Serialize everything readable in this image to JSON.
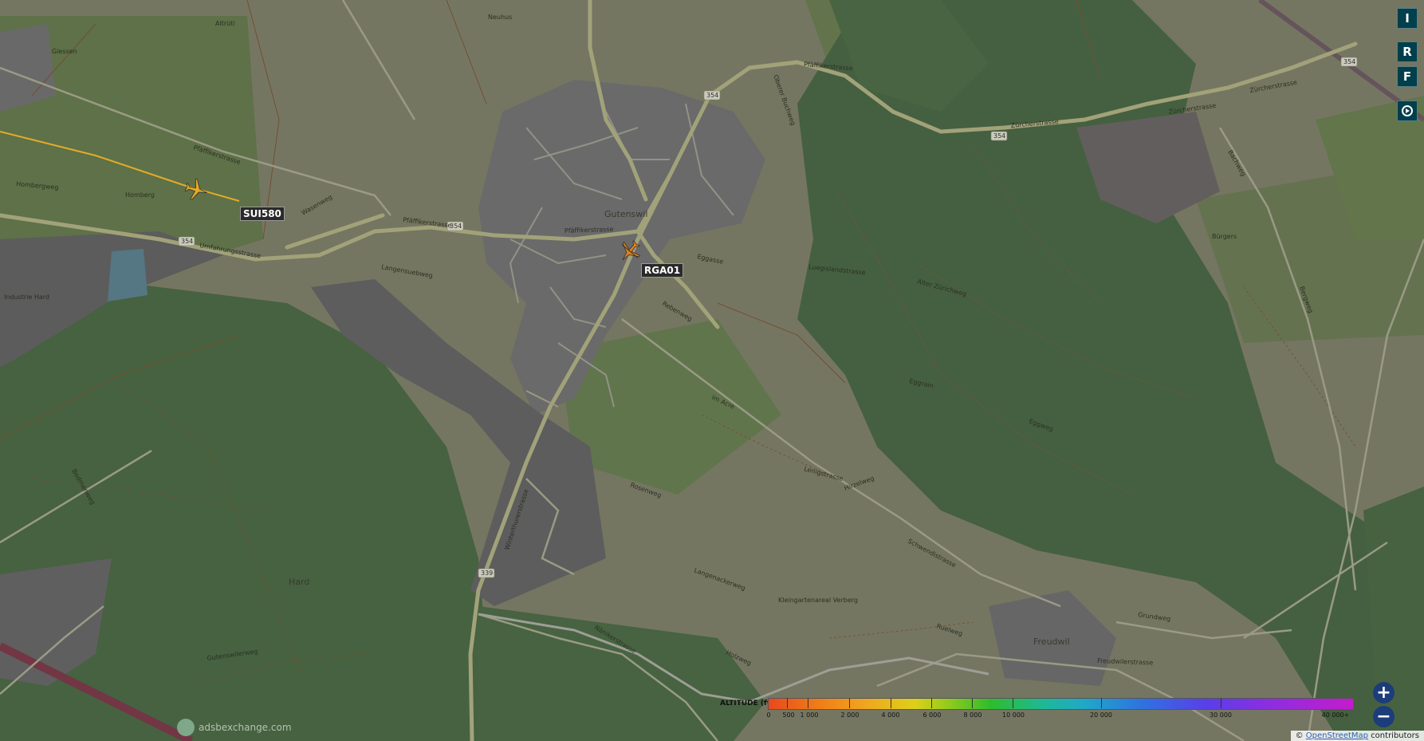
{
  "map": {
    "place_names": {
      "town": "Gutenswil",
      "village_se": "Freudwil",
      "forest": "Hard",
      "industry": "Industrie Hard",
      "hamlet_w": "Homberg",
      "area_nw": "Giessen",
      "hamlet_e": "Bürgers",
      "garden": "Kleingartenareal Verberg",
      "north_lbl": "Neuhus",
      "nw_lbl": "Altrüti"
    },
    "streets": {
      "pfaffikerstrasse_w": "Pfäffikerstrasse",
      "pfaffikerstrasse_c": "Pfäffikerstrasse",
      "pfaffikerstrasse_town": "Pfäffikerstrasse",
      "pfaffikerstrasse_ne": "Pfäffikerstrasse",
      "umfahrungsstrasse": "Umfahrungsstrasse",
      "zurcherstrasse_1": "Zürcherstrasse",
      "zurcherstrasse_2": "Zürcherstrasse",
      "zurcherstrasse_3": "Zürcherstrasse",
      "winterthurerstrasse": "Winterthurerstrasse",
      "langensuebweg": "Langensuebweg",
      "eggasse": "Eggasse",
      "luegislandstrasse": "Luegislandstrasse",
      "im_acre": "Im Acre",
      "schwendistrasse": "Schwendistrasse",
      "freudwilerstrasse": "Freudwilerstrasse",
      "nanikerstrasse": "Nänikerstrasse",
      "grundweg": "Grundweg",
      "alter_zurichweg": "Alter Zürichweg",
      "gutenswilerweg": "Gutenswilerweg",
      "lenigstrasse": "Lenigstrasse",
      "hombergweg": "Hombergweg",
      "ruelweg": "Ruelweg",
      "rebenweg": "Rebenweg",
      "langenackerweg": "Langenackerweg",
      "bergweg": "Bergweg",
      "oberer_bucheweg": "Oberer Buchweg",
      "eggweg": "Eggweg",
      "hirzelweg": "Hirzelweg",
      "holzweg": "Holzweg",
      "wasenweg": "Wasenweg",
      "rosenweg": "Rosenweg",
      "bachweg": "Bachweg",
      "bodmenweg": "Bodmenweg",
      "eggrain": "Eggrain"
    },
    "route_shields": {
      "r354_town_w": "354",
      "r354_w": "354",
      "r354_n": "354",
      "r354_ne": "354",
      "r354_fe": "354",
      "r339": "339"
    }
  },
  "aircraft": [
    {
      "callsign": "SUI580",
      "color": "#f3b62a"
    },
    {
      "callsign": "RGA01",
      "color": "#ef8a1c"
    }
  ],
  "controls": {
    "buttons": [
      "I",
      "R",
      "F"
    ],
    "zoom_in": "+",
    "zoom_out": "−"
  },
  "legend": {
    "title": "ALTITUDE (ft)",
    "ticks": [
      "0",
      "500",
      "1 000",
      "2 000",
      "4 000",
      "6 000",
      "8 000",
      "10 000",
      "20 000",
      "30 000",
      "40 000+"
    ]
  },
  "branding": {
    "logo_text": "adsbexchange.com"
  },
  "attribution": {
    "prefix": "©",
    "link": "OpenStreetMap",
    "suffix": "contributors"
  },
  "colors": {
    "farmland": "#7d7e68",
    "meadow": "#647a4c",
    "forest": "#4c6a46",
    "residential": "#707070",
    "industrial": "#626262",
    "road": "#a8a88a",
    "path": "#7a5a3a"
  }
}
